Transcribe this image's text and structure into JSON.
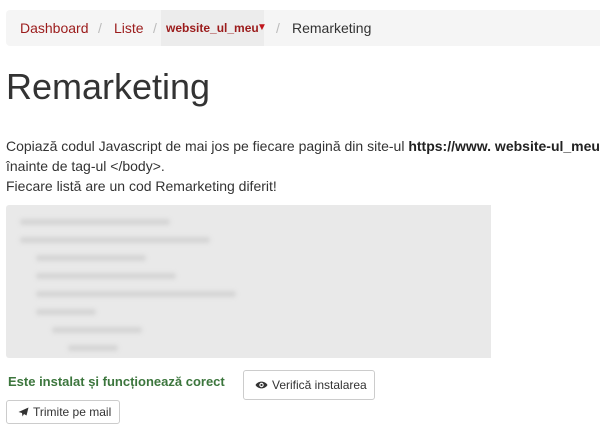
{
  "breadcrumb": {
    "dashboard": "Dashboard",
    "liste": "Liste",
    "separator": "/",
    "site_select": "website_ul_meu",
    "current": "Remarketing"
  },
  "page": {
    "title": "Remarketing",
    "desc_before": "Copiază codul Javascript de mai jos pe fiecare pagină din site-ul ",
    "desc_url": "https://www. website-ul_meu",
    "desc_line2": "înainte de tag-ul </body>.",
    "desc_line3": "Fiecare listă are un cod Remarketing diferit!"
  },
  "status": {
    "text": "Este instalat și funcționează corect",
    "color": "#3c763d"
  },
  "buttons": {
    "verify_label": "Verifică instalarea",
    "verify_icon": "eye-icon",
    "send_label": "Trimite pe mail",
    "send_icon": "paper-plane-icon"
  },
  "colors": {
    "link": "#9b1b1b",
    "caret": "#c0141b",
    "code_bg": "#e9e9e9"
  }
}
